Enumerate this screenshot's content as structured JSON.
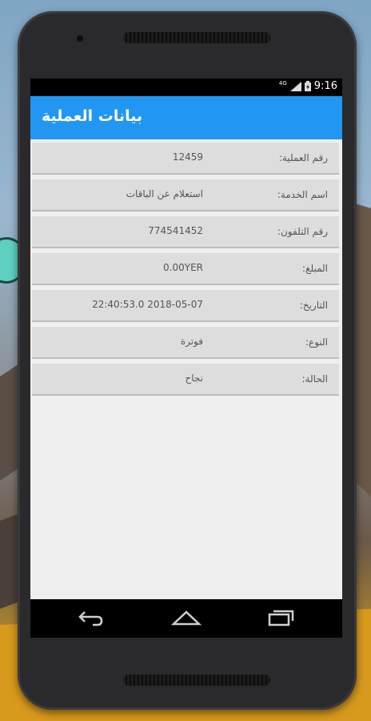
{
  "status_bar": {
    "network": "4G",
    "time": "9:16"
  },
  "app_bar": {
    "title": "بيانات العملية"
  },
  "details": [
    {
      "label": "رقم العملية:",
      "value": "12459"
    },
    {
      "label": "اسم الخدمة:",
      "value": "استعلام عن الباقات"
    },
    {
      "label": "رقم التلفون:",
      "value": "774541452"
    },
    {
      "label": "المبلغ:",
      "value": "0.00YER"
    },
    {
      "label": "التاريخ:",
      "value": "22:40:53.0 2018-05-07"
    },
    {
      "label": "النوع:",
      "value": "فوترة"
    },
    {
      "label": "الحالة:",
      "value": "نجاح"
    }
  ],
  "colors": {
    "app_bar": "#2196f3",
    "status_bar": "#000000",
    "row_background": "#dddddd"
  }
}
